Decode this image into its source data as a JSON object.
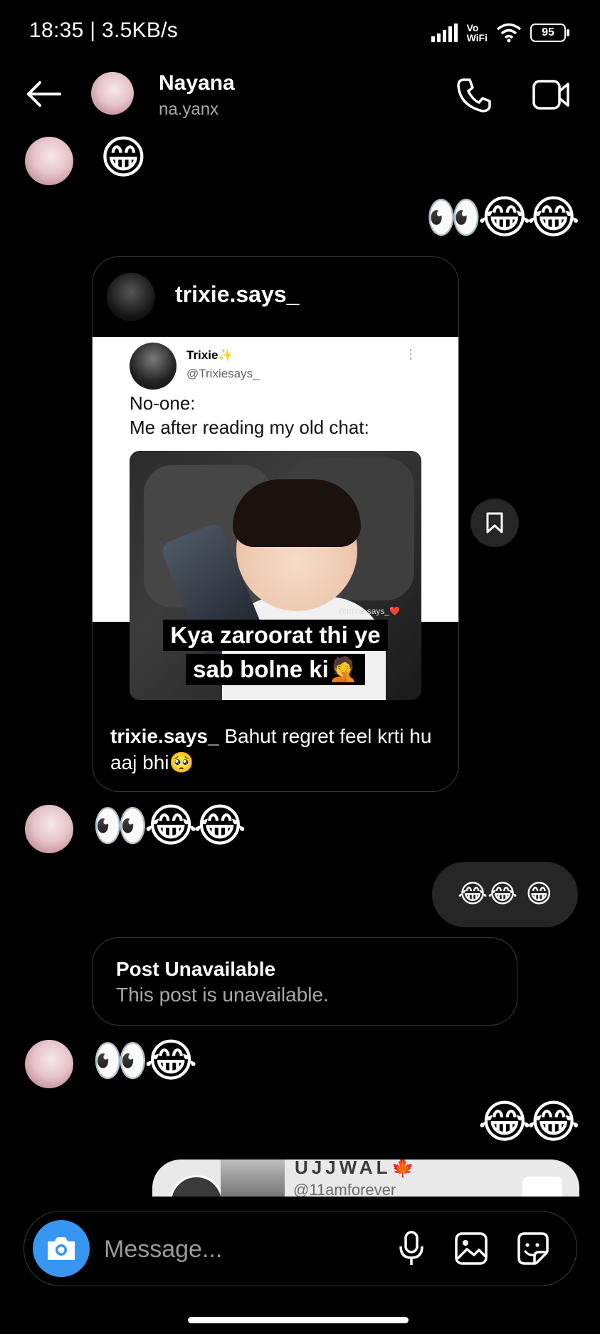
{
  "status_bar": {
    "time": "18:35",
    "speed": "3.5KB/s",
    "vowifi_top": "Vo",
    "vowifi_bottom": "WiFi",
    "battery": "95"
  },
  "header": {
    "name": "Nayana",
    "handle": "na.yanx",
    "back_icon": "arrow-left-icon",
    "call_icon": "phone-icon",
    "video_icon": "video-camera-icon"
  },
  "messages": {
    "m1": "😁",
    "m2": "👀😂😂",
    "shared_post": {
      "username": "trixie.says_",
      "tweet_name": "Trixie✨",
      "tweet_handle": "@Trixiesays_",
      "tweet_line1": "No-one:",
      "tweet_line2": "Me after reading my old chat:",
      "watermark": "@trixie.says_❤️",
      "meme_line1": "Kya zaroorat thi ye",
      "meme_line2": "sab bolne ki🤦",
      "caption_user": "trixie.says_",
      "caption_text": " Bahut regret feel krti hu aaj bhi🥺"
    },
    "m3": "👀😂😂",
    "m4": "😂😂 😁",
    "unavailable": {
      "title": "Post Unavailable",
      "subtitle": "This post is unavailable."
    },
    "m5": "👀😂",
    "m6": "😂😂",
    "reel_preview": {
      "name": "UJJWAL🍁",
      "handle": "@11amforever"
    }
  },
  "composer": {
    "placeholder": "Message...",
    "camera_icon": "camera-icon",
    "mic_icon": "microphone-icon",
    "gallery_icon": "image-icon",
    "sticker_icon": "sticker-icon"
  },
  "colors": {
    "background": "#000000",
    "accent": "#3797f0",
    "bubble": "#262626"
  }
}
